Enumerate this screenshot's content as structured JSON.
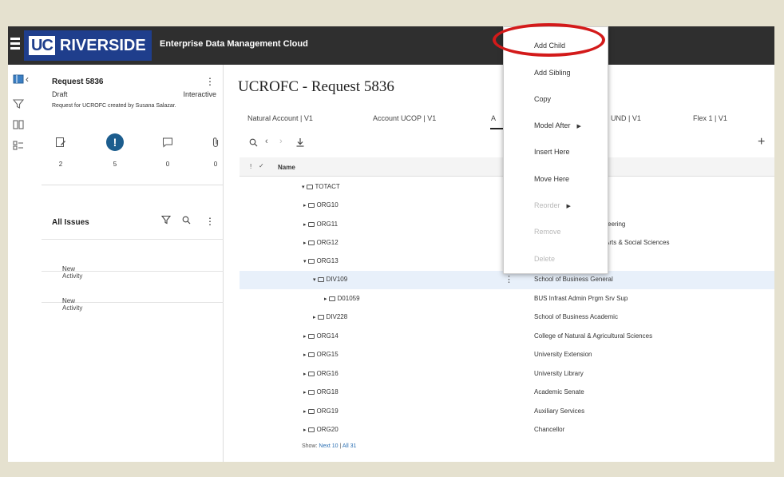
{
  "header": {
    "logo_uc": "UC",
    "logo_riverside": "RIVERSIDE",
    "app_title": "Enterprise Data Management Cloud"
  },
  "request": {
    "title": "Request 5836",
    "status": "Draft",
    "type": "Interactive",
    "description": "Request for UCROFC created by Susana Salazar.",
    "stats": [
      {
        "icon": "edit-icon",
        "count": "2"
      },
      {
        "icon": "alert-icon",
        "symbol": "!",
        "count": "5"
      },
      {
        "icon": "comment-icon",
        "count": "0"
      },
      {
        "icon": "attachment-icon",
        "count": "0"
      }
    ]
  },
  "issues": {
    "label": "All Issues",
    "items": [
      {
        "marker": "!",
        "label": "New Activity"
      },
      {
        "marker": "!",
        "label": "New Activity"
      }
    ]
  },
  "main": {
    "title": "UCROFC - Request 5836",
    "tabs": [
      {
        "label": "Natural Account | V1"
      },
      {
        "label": "Account UCOP | V1"
      },
      {
        "label": "A"
      },
      {
        "label": "UND | V1"
      },
      {
        "label": "Flex 1 | V1"
      }
    ],
    "grid_header": {
      "name": "Name"
    },
    "rows": [
      {
        "name": "TOTACT",
        "expanded": true,
        "desc": ""
      },
      {
        "name": "ORG10",
        "expanded": false,
        "desc": "..."
      },
      {
        "name": "ORG11",
        "expanded": false,
        "desc": "ngineering"
      },
      {
        "name": "ORG12",
        "expanded": false,
        "desc": "ies Arts & Social Sciences"
      },
      {
        "name": "ORG13",
        "expanded": true,
        "desc": ""
      },
      {
        "name": "DIV109",
        "expanded": true,
        "desc": "School of Business General"
      },
      {
        "name": "D01059",
        "expanded": false,
        "desc": "BUS Infrast Admin Prgm Srv Sup"
      },
      {
        "name": "DIV228",
        "expanded": false,
        "desc": "School of Business Academic"
      },
      {
        "name": "ORG14",
        "expanded": false,
        "desc": "College of Natural & Agricultural Sciences"
      },
      {
        "name": "ORG15",
        "expanded": false,
        "desc": "University Extension"
      },
      {
        "name": "ORG16",
        "expanded": false,
        "desc": "University Library"
      },
      {
        "name": "ORG18",
        "expanded": false,
        "desc": "Academic Senate"
      },
      {
        "name": "ORG19",
        "expanded": false,
        "desc": "Auxiliary Services"
      },
      {
        "name": "ORG20",
        "expanded": false,
        "desc": "Chancellor"
      }
    ],
    "show_more": {
      "prefix": "Show:",
      "next": "Next 10",
      "separator": "|",
      "all": "All 31"
    }
  },
  "context_menu": {
    "items": [
      {
        "label": "Add Child",
        "enabled": true,
        "submenu": false
      },
      {
        "label": "Add Sibling",
        "enabled": true,
        "submenu": false
      },
      {
        "label": "Copy",
        "enabled": true,
        "submenu": false
      },
      {
        "label": "Model After",
        "enabled": true,
        "submenu": true
      },
      {
        "label": "Insert Here",
        "enabled": true,
        "submenu": false
      },
      {
        "label": "Move Here",
        "enabled": true,
        "submenu": false
      },
      {
        "label": "Reorder",
        "enabled": false,
        "submenu": true
      },
      {
        "label": "Remove",
        "enabled": false,
        "submenu": false
      },
      {
        "label": "Delete",
        "enabled": false,
        "submenu": false
      }
    ],
    "highlight_color": "#d31a1a"
  },
  "colors": {
    "header_bg": "#2f2f2f",
    "logo_blue": "#1f3e8c",
    "selected_row": "#e8f0fa",
    "link": "#2a6fb3"
  }
}
